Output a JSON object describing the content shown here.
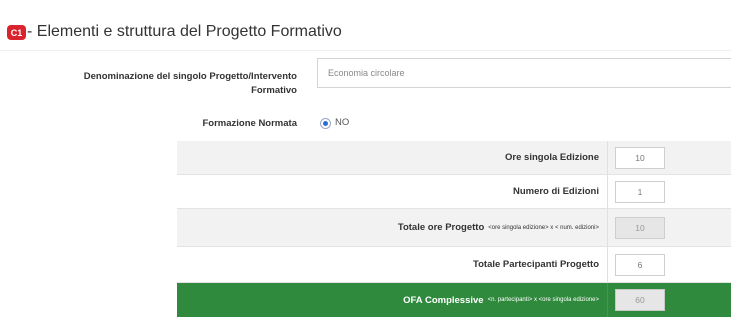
{
  "section": {
    "badge": "C1",
    "title": "- Elementi e struttura del Progetto Formativo"
  },
  "form": {
    "denominazione_label": "Denominazione del singolo Progetto/Intervento Formativo",
    "denominazione_value": "Economia circolare",
    "formazione_label": "Formazione Normata",
    "formazione_option": "NO",
    "formazione_selected": true
  },
  "table": {
    "rows": [
      {
        "label": "Ore singola Edizione",
        "note": "",
        "value": "10"
      },
      {
        "label": "Numero di Edizioni",
        "note": "",
        "value": "1"
      },
      {
        "label": "Totale ore Progetto",
        "note": "<ore singola edizione> x < num. edizioni>",
        "value": "10"
      },
      {
        "label": "Totale Partecipanti Progetto",
        "note": "",
        "value": "6"
      },
      {
        "label": "OFA Complessive",
        "note": "<n. partecipanti> x <ore singola edizione>",
        "value": "60"
      }
    ]
  },
  "colors": {
    "badge": "#d9232d",
    "highlight_row": "#2f8a3d",
    "radio_selected": "#2a6fd6"
  }
}
